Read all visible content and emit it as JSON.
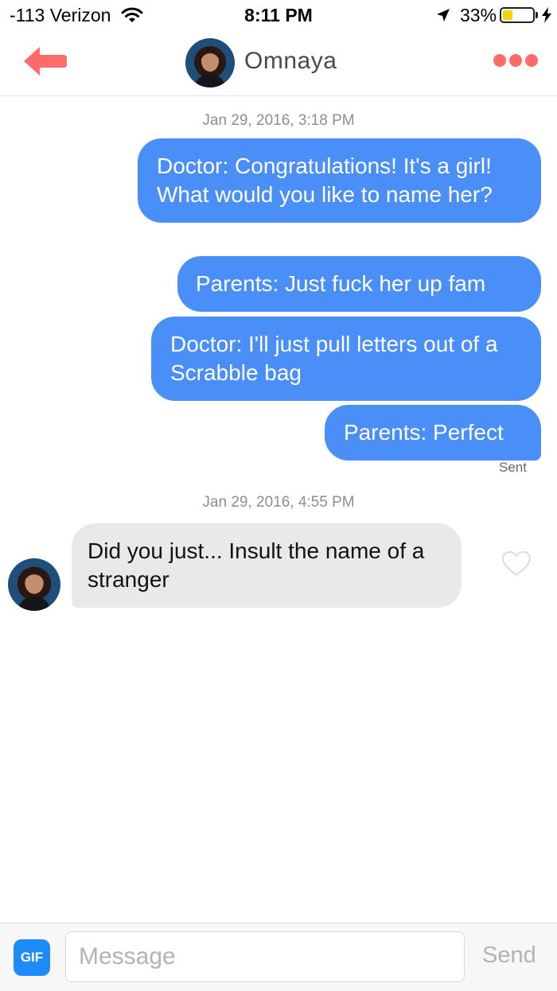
{
  "status_bar": {
    "carrier": "-113 Verizon",
    "time": "8:11 PM",
    "battery_percent": "33%",
    "battery_level": 0.33,
    "icons": [
      "wifi-icon",
      "location-arrow-icon",
      "battery-icon",
      "charging-bolt-icon"
    ]
  },
  "header": {
    "back_icon": "back-arrow-icon",
    "contact_name": "Omnaya",
    "more_icon": "more-dots-icon",
    "accent_color": "#ff6b6b"
  },
  "conversation": {
    "groups": [
      {
        "timestamp": "Jan 29, 2016, 3:18 PM",
        "messages": [
          "Doctor: Congratulations! It's a girl! What would you like to name her?",
          "Parents: Just fuck her up fam",
          "Doctor: I'll just pull letters out of a Scrabble bag",
          "Parents: Perfect"
        ],
        "status": "Sent"
      },
      {
        "timestamp": "Jan 29, 2016, 4:55 PM",
        "incoming": "Did you just... Insult the name of a stranger",
        "like_icon": "heart-outline-icon"
      }
    ],
    "outgoing_color": "#4a8ef7",
    "incoming_color": "#e9e9eb"
  },
  "input_bar": {
    "gif_label": "GIF",
    "placeholder": "Message",
    "send_label": "Send"
  }
}
